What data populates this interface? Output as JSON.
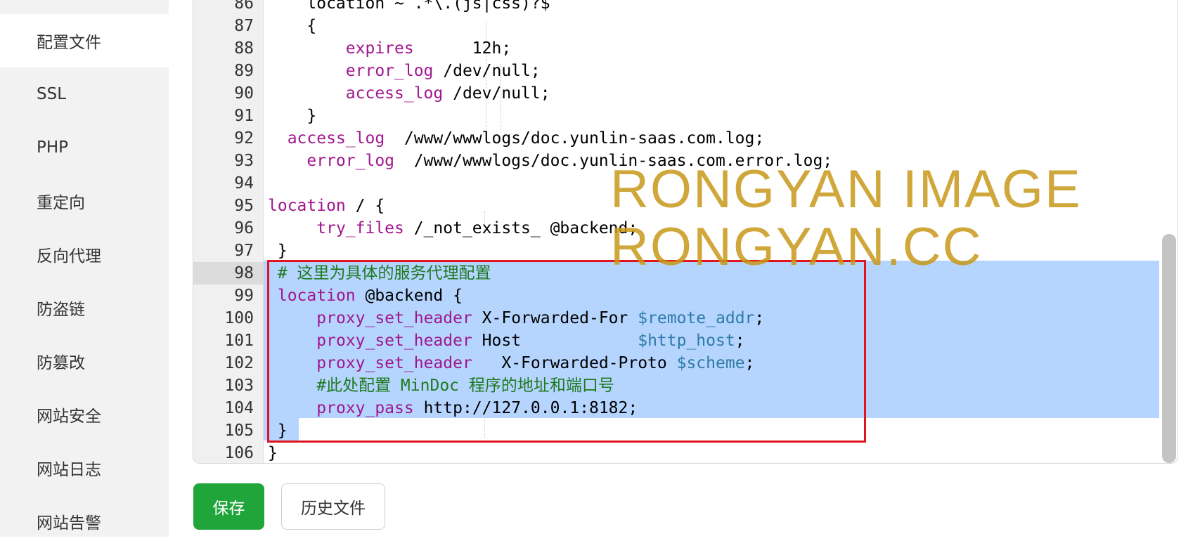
{
  "sidebar": {
    "items": [
      {
        "label": "配置文件",
        "active": true
      },
      {
        "label": "SSL"
      },
      {
        "label": "PHP"
      },
      {
        "label": "重定向"
      },
      {
        "label": "反向代理"
      },
      {
        "label": "防盗链"
      },
      {
        "label": "防篡改"
      },
      {
        "label": "网站安全"
      },
      {
        "label": "网站日志"
      },
      {
        "label": "网站告警"
      }
    ]
  },
  "editor": {
    "lines": [
      {
        "num": "86",
        "parts": [
          "    location ~ .*\\.(js|css)?$"
        ]
      },
      {
        "num": "87",
        "parts": [
          "    {"
        ]
      },
      {
        "num": "88",
        "parts": [
          "        ",
          "expires",
          "      12h;"
        ]
      },
      {
        "num": "89",
        "parts": [
          "        ",
          "error_log",
          " /dev/null;"
        ]
      },
      {
        "num": "90",
        "parts": [
          "        ",
          "access_log",
          " /dev/null;"
        ]
      },
      {
        "num": "91",
        "parts": [
          "    }"
        ]
      },
      {
        "num": "92",
        "parts": [
          "  ",
          "access_log",
          "  /www/wwwlogs/doc.yunlin-saas.com.log;"
        ]
      },
      {
        "num": "93",
        "parts": [
          "    ",
          "error_log",
          "  /www/wwwlogs/doc.yunlin-saas.com.error.log;"
        ]
      },
      {
        "num": "94",
        "parts": [
          ""
        ]
      },
      {
        "num": "95",
        "parts": [
          "location",
          " / {"
        ]
      },
      {
        "num": "96",
        "parts": [
          "     ",
          "try_files",
          " /_not_exists_ @backend;"
        ]
      },
      {
        "num": "97",
        "parts": [
          " }"
        ]
      },
      {
        "num": "98",
        "parts": [
          " # 这里为具体的服务代理配置"
        ]
      },
      {
        "num": "99",
        "parts": [
          " ",
          "location",
          " @backend {"
        ]
      },
      {
        "num": "100",
        "parts": [
          "     ",
          "proxy_set_header",
          " X-Forwarded-For ",
          "$remote_addr",
          ";"
        ]
      },
      {
        "num": "101",
        "parts": [
          "     ",
          "proxy_set_header",
          " Host            ",
          "$http_host",
          ";"
        ]
      },
      {
        "num": "102",
        "parts": [
          "     ",
          "proxy_set_header",
          "   X-Forwarded-Proto ",
          "$scheme",
          ";"
        ]
      },
      {
        "num": "103",
        "parts": [
          "     #此处配置 MinDoc 程序的地址和端口号"
        ]
      },
      {
        "num": "104",
        "parts": [
          "     ",
          "proxy_pass",
          " http://127.0.0.1:8182;"
        ]
      },
      {
        "num": "105",
        "parts": [
          " }"
        ]
      },
      {
        "num": "106",
        "parts": [
          "}"
        ]
      }
    ]
  },
  "watermark": {
    "line1": "RONGYAN IMAGE",
    "line2": "RONGYAN.CC"
  },
  "buttons": {
    "save": "保存",
    "history": "历史文件"
  },
  "colors": {
    "save_button": "#20a53a",
    "selection": "#b5d5ff",
    "highlight_box": "#e0141e"
  }
}
